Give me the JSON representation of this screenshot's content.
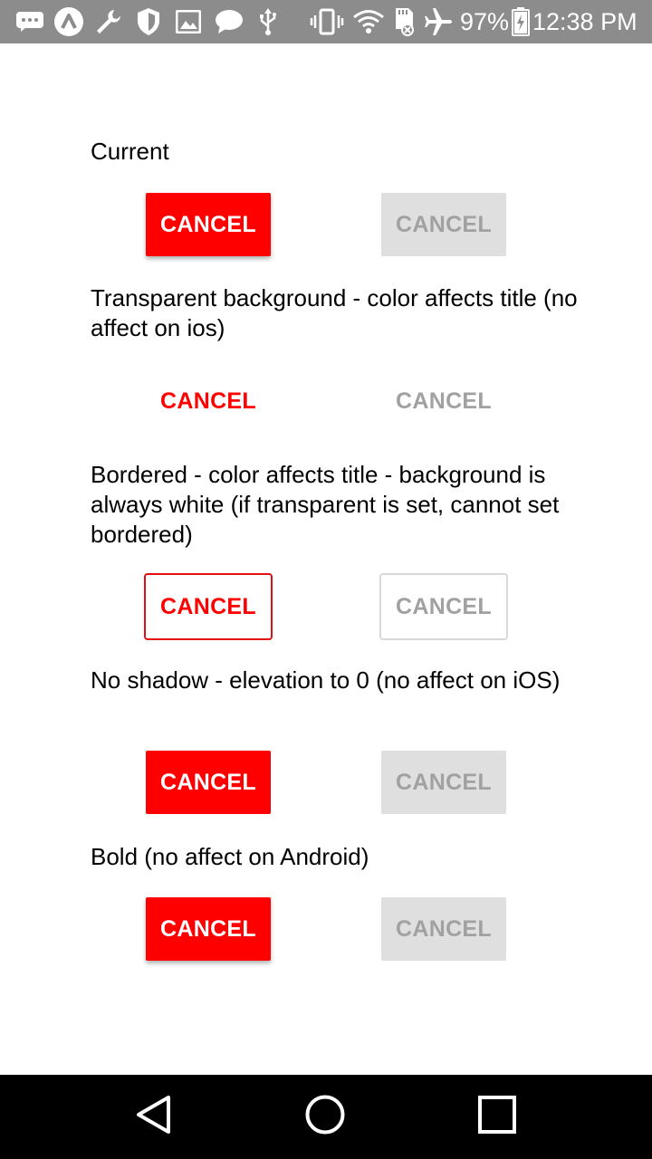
{
  "status_bar": {
    "battery_percent": "97%",
    "time": "12:38 PM",
    "icons": [
      "messages-icon",
      "app-icon",
      "wrench-icon",
      "shield-icon",
      "image-icon",
      "chat-icon",
      "usb-icon",
      "vibrate-icon",
      "wifi-icon",
      "sd-card-icon",
      "airplane-mode-icon",
      "battery-charging-icon"
    ]
  },
  "sections": [
    {
      "label": "Current",
      "primary_label": "CANCEL",
      "disabled_label": "CANCEL"
    },
    {
      "label": "Transparent background - color affects title (no affect on ios)",
      "primary_label": "CANCEL",
      "disabled_label": "CANCEL"
    },
    {
      "label": "Bordered - color affects title - background is always white (if transparent is set, cannot set bordered)",
      "primary_label": "CANCEL",
      "disabled_label": "CANCEL"
    },
    {
      "label": "No shadow - elevation to 0 (no affect on iOS)",
      "primary_label": "CANCEL",
      "disabled_label": "CANCEL"
    },
    {
      "label": "Bold (no affect on Android)",
      "primary_label": "CANCEL",
      "disabled_label": "CANCEL"
    }
  ],
  "colors": {
    "accent": "#ff0000",
    "disabled_bg": "#dfdfdf",
    "disabled_text": "#a1a1a1",
    "status_bar": "#8c8c8c",
    "nav_bar": "#000000"
  },
  "nav_bar": {
    "icons": [
      "back-icon",
      "home-icon",
      "recents-icon"
    ]
  }
}
